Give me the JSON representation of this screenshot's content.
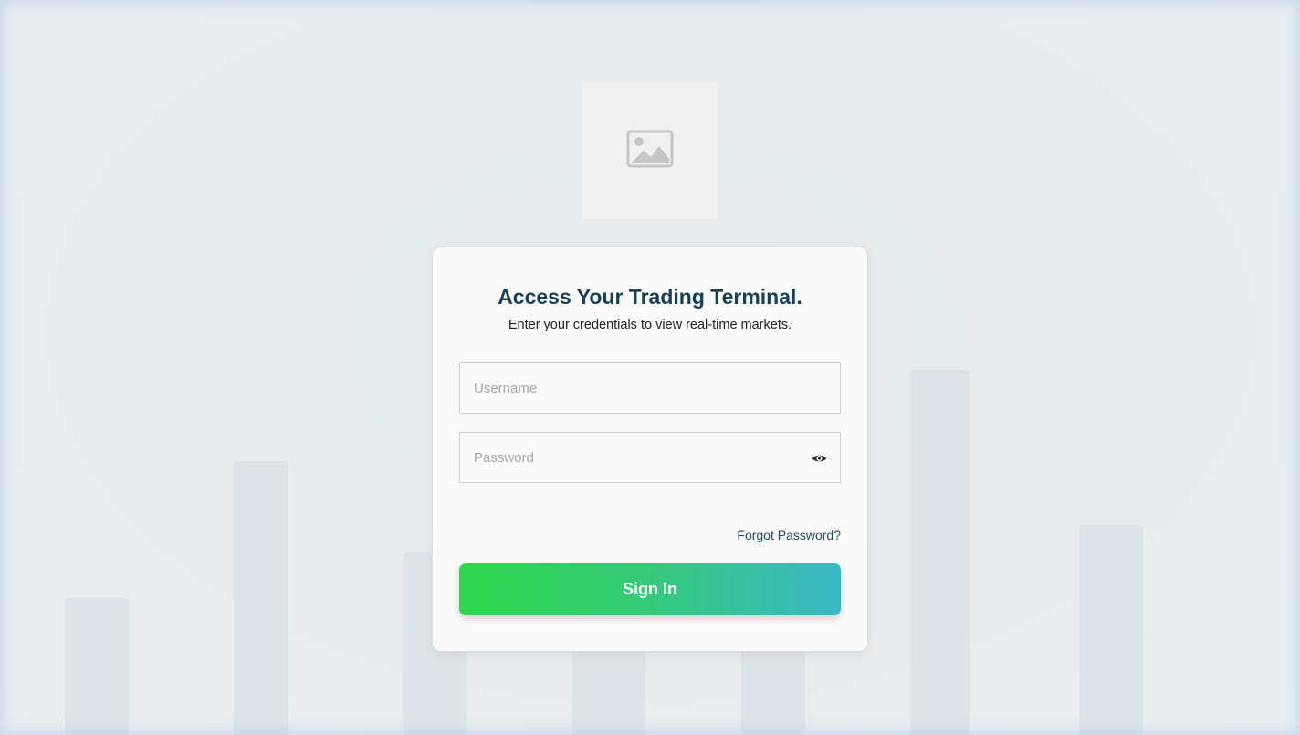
{
  "login": {
    "title": "Access Your Trading Terminal.",
    "subtitle": "Enter your credentials to view real-time markets.",
    "username_placeholder": "Username",
    "username_value": "",
    "password_placeholder": "Password",
    "password_value": "",
    "forgot_label": "Forgot Password?",
    "signin_label": "Sign In"
  },
  "logo": {
    "icon": "image-placeholder-icon"
  },
  "icons": {
    "password_toggle": "eye-icon"
  },
  "colors": {
    "title": "#174256",
    "link": "#1f4f66",
    "button_gradient_start": "#2ed84c",
    "button_gradient_end": "#3ab7c6"
  }
}
